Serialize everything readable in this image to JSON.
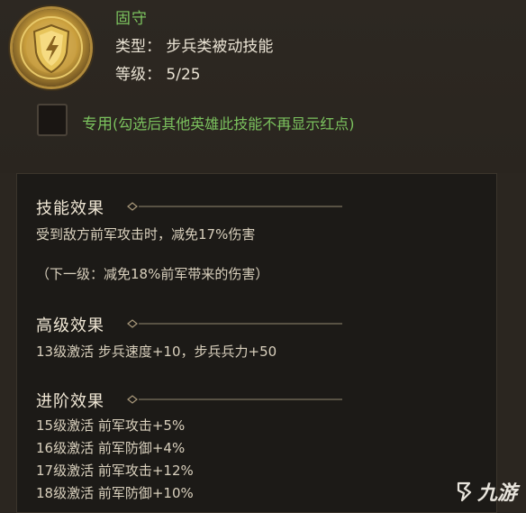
{
  "skill": {
    "name": "固守",
    "type_text": "类型：  步兵类被动技能",
    "level_text": "等级：  5/25",
    "icon": "shield-lightning-icon"
  },
  "exclusive": {
    "label": "专用",
    "hint": "(勾选后其他英雄此技能不再显示红点)"
  },
  "sections": [
    {
      "title": "技能效果",
      "lines": [
        "受到敌方前军攻击时，减免17%伤害",
        "",
        "（下一级：减免18%前军带来的伤害）"
      ]
    },
    {
      "title": "高级效果",
      "lines": [
        "13级激活  步兵速度+10，步兵兵力+50"
      ]
    },
    {
      "title": "进阶效果",
      "lines": [
        "15级激活  前军攻击+5%",
        "16级激活  前军防御+4%",
        "17级激活  前军攻击+12%",
        "18级激活  前军防御+10%"
      ]
    }
  ],
  "watermark": {
    "text": "九游",
    "icon": "jiuyou-logo-icon"
  }
}
